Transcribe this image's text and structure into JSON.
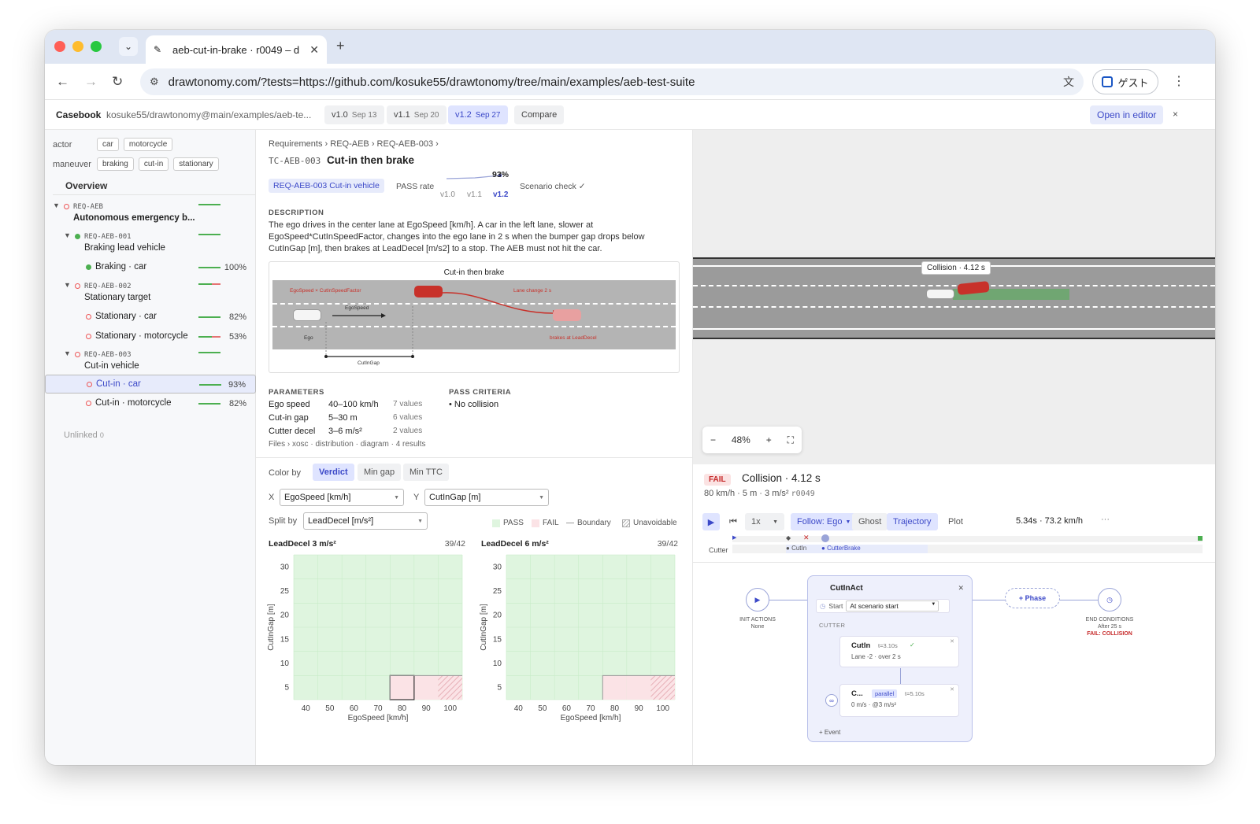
{
  "browser": {
    "tab_title": "aeb-cut-in-brake · r0049 – d",
    "url": "drawtonomy.com/?tests=https://github.com/kosuke55/drawtonomy/tree/main/examples/aeb-test-suite",
    "guest_label": "ゲスト"
  },
  "header": {
    "brand": "Casebook",
    "repo_path": "kosuke55/drawtonomy@main/examples/aeb-te...",
    "versions": [
      {
        "label": "v1.0",
        "date": "Sep 13"
      },
      {
        "label": "v1.1",
        "date": "Sep 20"
      },
      {
        "label": "v1.2",
        "date": "Sep 27"
      }
    ],
    "compare_label": "Compare",
    "open_editor_label": "Open in editor",
    "close_label": "×"
  },
  "sidebar": {
    "actor_label": "actor",
    "actor_chips": [
      "car",
      "motorcycle"
    ],
    "maneuver_label": "maneuver",
    "maneuver_chips": [
      "braking",
      "cut-in",
      "stationary"
    ],
    "overview_label": "Overview",
    "tree": {
      "root_id": "REQ-AEB",
      "root_name": "Autonomous emergency b...",
      "r1_id": "REQ-AEB-001",
      "r1_name": "Braking lead vehicle",
      "r1c1_name": "Braking · car",
      "r1c1_pct": "100%",
      "r2_id": "REQ-AEB-002",
      "r2_name": "Stationary target",
      "r2c1_name": "Stationary · car",
      "r2c1_pct": "82%",
      "r2c2_name": "Stationary · motorcycle",
      "r2c2_pct": "53%",
      "r3_id": "REQ-AEB-003",
      "r3_name": "Cut-in vehicle",
      "r3c1_name": "Cut-in · car",
      "r3c1_pct": "93%",
      "r3c2_name": "Cut-in · motorcycle",
      "r3c2_pct": "82%"
    },
    "unlinked_label": "Unlinked",
    "unlinked_count": "0"
  },
  "detail": {
    "breadcrumb": "Requirements › REQ-AEB › REQ-AEB-003 ›",
    "tc_id": "TC-AEB-003",
    "title": "Cut-in then brake",
    "req_badge": "REQ-AEB-003 Cut-in vehicle",
    "pass_rate_label": "PASS rate",
    "pass_rate_value": "93%",
    "pass_rate_versions": [
      "v1.0",
      "v1.1",
      "v1.2"
    ],
    "scenario_check": "Scenario check ✓",
    "description_label": "DESCRIPTION",
    "description": "The ego drives in the center lane at EgoSpeed [km/h]. A car in the left lane, slower at EgoSpeed*CutInSpeedFactor, changes into the ego lane in 2 s when the bumper gap drops below CutInGap [m], then brakes at LeadDecel [m/s2] to a stop. The AEB must not hit the car.",
    "diagram": {
      "title": "Cut-in then brake",
      "speed_label": "EgoSpeed × CutInSpeedFactor",
      "ego_speed": "EgoSpeed",
      "lane_change": "Lane change 2 s",
      "ego": "Ego",
      "brakes": "brakes at LeadDecel",
      "gap": "CutInGap"
    },
    "parameters_label": "PARAMETERS",
    "parameters": [
      {
        "name": "Ego speed",
        "range": "40–100 km/h",
        "count": "7 values"
      },
      {
        "name": "Cut-in gap",
        "range": "5–30 m",
        "count": "6 values"
      },
      {
        "name": "Cutter decel",
        "range": "3–6 m/s²",
        "count": "2 values"
      }
    ],
    "pass_criteria_label": "PASS CRITERIA",
    "pass_criteria": "No collision",
    "files": "Files › xosc · distribution · diagram · 4 results"
  },
  "results": {
    "color_by_label": "Color by",
    "color_by_options": [
      "Verdict",
      "Min gap",
      "Min TTC"
    ],
    "x_label": "X",
    "x_value": "EgoSpeed [km/h]",
    "y_label": "Y",
    "y_value": "CutInGap [m]",
    "split_label": "Split by",
    "split_value": "LeadDecel [m/s²]",
    "legend": [
      "PASS",
      "FAIL",
      "Boundary",
      "Unavoidable"
    ],
    "colors": {
      "pass": "#dff5df",
      "fail": "#fbe3e6",
      "accent": "#3c49c8"
    }
  },
  "chart_data": [
    {
      "type": "heatmap",
      "title": "LeadDecel 3 m/s²",
      "count": "39/42",
      "xlabel": "EgoSpeed [km/h]",
      "ylabel": "CutInGap [m]",
      "x": [
        40,
        50,
        60,
        70,
        80,
        90,
        100
      ],
      "y": [
        5,
        10,
        15,
        20,
        25,
        30
      ],
      "xticks": [
        "40",
        "50",
        "60",
        "70",
        "80",
        "90",
        "100"
      ],
      "yticks": [
        "30",
        "25",
        "20",
        "15",
        "10",
        "5"
      ],
      "cells_at_gap_5": [
        "PASS",
        "PASS",
        "PASS",
        "PASS",
        "Boundary",
        "FAIL",
        "Unavoidable"
      ]
    },
    {
      "type": "heatmap",
      "title": "LeadDecel 6 m/s²",
      "count": "39/42",
      "xlabel": "EgoSpeed [km/h]",
      "ylabel": "CutInGap [m]",
      "x": [
        40,
        50,
        60,
        70,
        80,
        90,
        100
      ],
      "y": [
        5,
        10,
        15,
        20,
        25,
        30
      ],
      "xticks": [
        "40",
        "50",
        "60",
        "70",
        "80",
        "90",
        "100"
      ],
      "yticks": [
        "30",
        "25",
        "20",
        "15",
        "10",
        "5"
      ],
      "cells_at_gap_5": [
        "PASS",
        "PASS",
        "PASS",
        "PASS",
        "FAIL",
        "FAIL",
        "Unavoidable"
      ]
    }
  ],
  "sim": {
    "collision_tag": "Collision · 4.12 s",
    "zoom": "48%",
    "verdict": "FAIL",
    "result_title": "Collision · 4.12 s",
    "result_sub": "80 km/h · 5 m · 3 m/s²",
    "run_id": "r0049",
    "speed": "1x",
    "follow": "Follow: Ego",
    "ghost": "Ghost",
    "trajectory": "Trajectory",
    "plot": "Plot",
    "time_readout": "5.34s · 73.2 km/h",
    "more": "···",
    "cutter_label": "Cutter",
    "track_cutin": "CutIn",
    "track_brake": "CutterBrake"
  },
  "phase": {
    "init_label": "INIT ACTIONS",
    "init_value": "None",
    "card_title": "CutInAct",
    "start_label": "Start",
    "start_value": "At scenario start",
    "cutter_label": "CUTTER",
    "evt1_name": "CutIn",
    "evt1_time": "t=3.10s",
    "evt1_detail": "Lane -2 · over 2 s",
    "evt2_name": "C...",
    "evt2_pill": "parallel",
    "evt2_time": "t=5.10s",
    "evt2_detail": "0 m/s · @3 m/s²",
    "add_event": "+ Event",
    "add_phase": "+ Phase",
    "end_label": "END CONDITIONS",
    "end_value": "After 25 s",
    "end_fail": "FAIL: COLLISION"
  }
}
